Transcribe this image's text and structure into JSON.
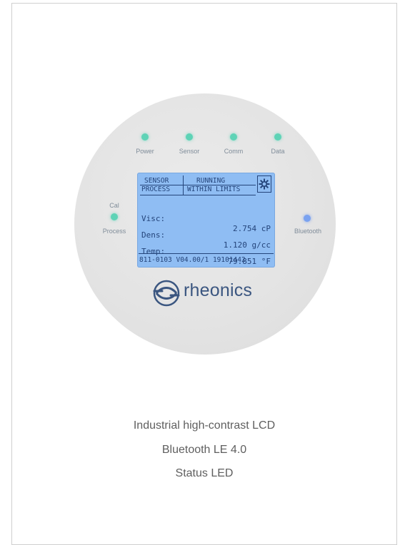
{
  "leds": {
    "power": "Power",
    "sensor": "Sensor",
    "comm": "Comm",
    "data": "Data",
    "cal": "Cal",
    "process": "Process",
    "bluetooth": "Bluetooth"
  },
  "lcd": {
    "header": {
      "sensor": "SENSOR",
      "running": "RUNNING",
      "process": "PROCESS",
      "within_limits": "WITHIN LIMITS"
    },
    "rows": [
      {
        "label": "Visc:",
        "value": "2.754 cP"
      },
      {
        "label": "Dens:",
        "value": "1.120 g/cc"
      },
      {
        "label": "Temp:",
        "value": "79.851 °F"
      }
    ],
    "footer": "811-0103 V04.00/1 19101442"
  },
  "brand": {
    "name": "rheonics",
    "color": "#3b5680"
  },
  "features": [
    "Industrial high-contrast LCD",
    "Bluetooth LE 4.0",
    "Status LED"
  ],
  "colors": {
    "led_green": "#5ed3b6",
    "led_blue": "#7aa2f0",
    "lcd_background": "#8fbdf3",
    "lcd_text": "#24447a"
  },
  "icons": {
    "lcd_status": "gear-icon",
    "brand": "rheonics-logo-icon"
  }
}
